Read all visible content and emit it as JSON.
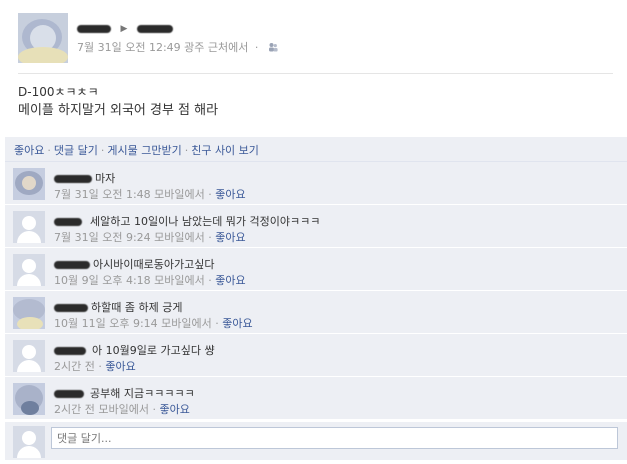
{
  "post": {
    "author_redacted": true,
    "timestamp": "7월 31일 오전 12:49",
    "location": "광주 근처에서",
    "dot": "·",
    "audience_icon": "people-icon",
    "line1": "D-100ㅊㅋㅊㅋ",
    "line2": "메이플 하지말거 외국어 경부 점 해라"
  },
  "actions": {
    "like": "좋아요",
    "comment": "댓글 달기",
    "unfollow": "게시물 그만받기",
    "friendship": "친구 사이 보기",
    "separator": "·"
  },
  "comments": [
    {
      "text": "마자",
      "time": "7월 31일 오전 1:48",
      "via": "모바일에서",
      "like": "좋아요",
      "avatar": "photo"
    },
    {
      "text": "세알하고 10일이나 남았는데 뭐가 걱정이야ㅋㅋㅋ",
      "time": "7월 31일 오전 9:24",
      "via": "모바일에서",
      "like": "좋아요",
      "avatar": "default"
    },
    {
      "text": "아시바이때로동아가고싶다",
      "time": "10월 9일 오후 4:18",
      "via": "모바일에서",
      "like": "좋아요",
      "avatar": "default"
    },
    {
      "text": "하할때 좀 하제 긍게",
      "time": "10월 11일 오후 9:14",
      "via": "모바일에서",
      "like": "좋아요",
      "avatar": "photo"
    },
    {
      "text": "아 10월9일로 가고싶다 썅",
      "time": "2시간 전",
      "via": "",
      "like": "좋아요",
      "avatar": "default"
    },
    {
      "text": "공부해 지금ㅋㅋㅋㅋㅋ",
      "time": "2시간 전",
      "via": "모바일에서",
      "like": "좋아요",
      "avatar": "photo"
    }
  ],
  "reply": {
    "placeholder": "댓글 달기..."
  },
  "colors": {
    "link": "#3b5998",
    "panel": "#edeff4",
    "meta": "#999999"
  }
}
